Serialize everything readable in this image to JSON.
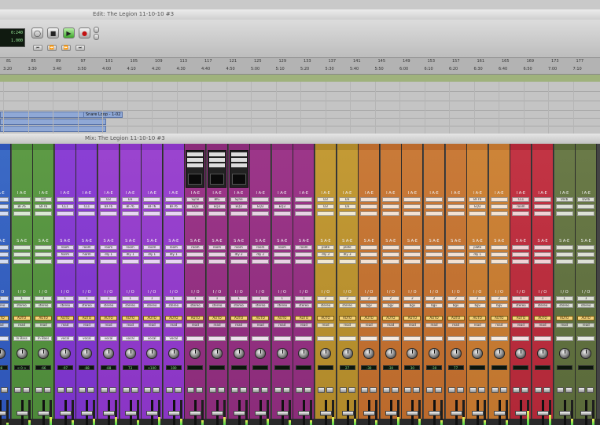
{
  "edit": {
    "title": "Edit: The Legion 11-10-10 #3",
    "counter_main": "0:240",
    "counter_sub": "1.000",
    "bar_numbers": [
      "81",
      "85",
      "89",
      "97",
      "101",
      "105",
      "109",
      "113",
      "117",
      "121",
      "125",
      "129",
      "133",
      "137",
      "141",
      "145",
      "149",
      "153",
      "157",
      "161",
      "165",
      "169",
      "173",
      "177"
    ],
    "time_marks": [
      "3:20",
      "3:30",
      "3:40",
      "3:50",
      "4:00",
      "4:10",
      "4:20",
      "4:30",
      "4:40",
      "4:50",
      "5:00",
      "5:10",
      "5:20",
      "5:30",
      "5:40",
      "5:50",
      "6:00",
      "6:10",
      "6:20",
      "6:30",
      "6:40",
      "6:50",
      "7:00",
      "7:10"
    ],
    "clip_label": "Snare Loop - 1-02"
  },
  "mix": {
    "title": "Mix: The Legion 11-10-10 #3",
    "strips": [
      {
        "color": "#2e55b8",
        "body": "#3b6ac5",
        "insert_a": "",
        "insert_b": "",
        "send_a": "",
        "send_b": "",
        "io": "1",
        "io_b": "stereo",
        "group": "",
        "pan": "-88",
        "meter": 0.1
      },
      {
        "color": "#4d8a3a",
        "body": "#5d9a45",
        "insert_a": "",
        "insert_b": "BF76",
        "send_a": "",
        "send_b": "",
        "io": "1",
        "io_b": "stereo",
        "group": "In Bass",
        "pan": "< 0 >",
        "meter": 0.2
      },
      {
        "color": "#4d8a3a",
        "body": "#5d9a45",
        "insert_a": "Filt",
        "insert_b": "BF76",
        "send_a": "",
        "send_b": "",
        "io": "1",
        "io_b": "stereo",
        "group": "In Bass",
        "pan": "-66",
        "meter": 0.3
      },
      {
        "color": "#7a33c8",
        "body": "#8a3fd4",
        "insert_a": "",
        "insert_b": "CL1",
        "send_a": "room",
        "send_b": "harm",
        "io": "1",
        "io_b": "stereo",
        "group": "vocal",
        "pan": "-97",
        "meter": 0.2
      },
      {
        "color": "#7a33c8",
        "body": "#8a3fd4",
        "insert_a": "",
        "insert_b": "CL1",
        "send_a": "room",
        "send_b": "harm",
        "io": "1",
        "io_b": "stereo",
        "group": "vocal",
        "pan": "-88",
        "meter": 0.25
      },
      {
        "color": "#8a35c5",
        "body": "#9a44cf",
        "insert_a": "D3",
        "insert_b": "BF76",
        "send_a": "room",
        "send_b": "dly 1",
        "io": "1",
        "io_b": "stereo",
        "group": "vocal",
        "pan": "-88",
        "meter": 0.3
      },
      {
        "color": "#8a35c5",
        "body": "#9a44cf",
        "insert_a": "D3",
        "insert_b": "BF76",
        "send_a": "room",
        "send_b": "dly 1",
        "io": "1",
        "io_b": "stereo",
        "group": "vocal",
        "pan": "73",
        "meter": 0.2
      },
      {
        "color": "#8a35c5",
        "body": "#9a44cf",
        "insert_a": "",
        "insert_b": "BF76",
        "send_a": "room",
        "send_b": "dly 1",
        "io": "1",
        "io_b": "stereo",
        "group": "vocal",
        "pan": "+100",
        "meter": 0.3
      },
      {
        "color": "#8a35c5",
        "body": "#9a44cf",
        "insert_a": "",
        "insert_b": "BF76",
        "send_a": "room",
        "send_b": "dly 1",
        "io": "1",
        "io_b": "stereo",
        "group": "vocal",
        "pan": "100",
        "meter": 0.25
      },
      {
        "color": "#8b2c7a",
        "body": "#9c3689",
        "insert_a": "Syne",
        "insert_b": "EQ3",
        "send_a": "room",
        "send_b": "",
        "io": "1",
        "io_b": "stereo",
        "group": "",
        "pan": "",
        "meter": 0.2
      },
      {
        "color": "#8b2c7a",
        "body": "#9c3689",
        "insert_a": "BIG",
        "insert_b": "EQ3",
        "send_a": "room",
        "send_b": "",
        "io": "1",
        "io_b": "stereo",
        "group": "",
        "pan": "",
        "meter": 0.3
      },
      {
        "color": "#8b2c7a",
        "body": "#9c3689",
        "insert_a": "Syne",
        "insert_b": "EQ3",
        "send_a": "room",
        "send_b": "dly 2",
        "io": "1",
        "io_b": "stereo",
        "group": "",
        "pan": "",
        "meter": 0.2
      },
      {
        "color": "#8b2c7a",
        "body": "#9c3689",
        "insert_a": "",
        "insert_b": "EQ3",
        "send_a": "room",
        "send_b": "dly 2",
        "io": "1",
        "io_b": "stereo",
        "group": "",
        "pan": "",
        "meter": 0.25
      },
      {
        "color": "#8b2c7a",
        "body": "#9c3689",
        "insert_a": "",
        "insert_b": "EQ3",
        "send_a": "room",
        "send_b": "",
        "io": "1",
        "io_b": "stereo",
        "group": "",
        "pan": "",
        "meter": 0.2
      },
      {
        "color": "#8b2c7a",
        "body": "#9c3689",
        "insert_a": "",
        "insert_b": "",
        "send_a": "room",
        "send_b": "",
        "io": "1",
        "io_b": "stereo",
        "group": "",
        "pan": "",
        "meter": 0.2
      },
      {
        "color": "#b0892a",
        "body": "#c39a35",
        "insert_a": "D3",
        "insert_b": "D3",
        "send_a": "plate",
        "send_b": "dly 3",
        "io": "2",
        "io_b": "stereo",
        "group": "",
        "pan": "",
        "meter": 0.3
      },
      {
        "color": "#b0892a",
        "body": "#c39a35",
        "insert_a": "D3",
        "insert_b": "D3",
        "send_a": "plate",
        "send_b": "dly 3",
        "io": "2",
        "io_b": "stereo",
        "group": "",
        "pan": "27",
        "meter": 0.25
      },
      {
        "color": "#bb6a2c",
        "body": "#c97a38",
        "insert_a": "",
        "insert_b": "",
        "send_a": "",
        "send_b": "",
        "io": "2",
        "io_b": "bgv",
        "group": "",
        "pan": "-30",
        "meter": 0.2
      },
      {
        "color": "#bb6a2c",
        "body": "#c97a38",
        "insert_a": "",
        "insert_b": "",
        "send_a": "",
        "send_b": "",
        "io": "2",
        "io_b": "bgv",
        "group": "",
        "pan": "-30",
        "meter": 0.3
      },
      {
        "color": "#bb6a2c",
        "body": "#c97a38",
        "insert_a": "",
        "insert_b": "",
        "send_a": "",
        "send_b": "",
        "io": "2",
        "io_b": "bgv",
        "group": "",
        "pan": "30",
        "meter": 0.25
      },
      {
        "color": "#bb6a2c",
        "body": "#c97a38",
        "insert_a": "",
        "insert_b": "",
        "send_a": "",
        "send_b": "",
        "io": "2",
        "io_b": "bgv",
        "group": "",
        "pan": "-30",
        "meter": 0.2
      },
      {
        "color": "#bb6a2c",
        "body": "#c97a38",
        "insert_a": "",
        "insert_b": "",
        "send_a": "",
        "send_b": "",
        "io": "2",
        "io_b": "bgv",
        "group": "",
        "pan": "77",
        "meter": 0.3
      },
      {
        "color": "#c0752e",
        "body": "#cd8438",
        "insert_a": "BF76",
        "insert_b": "EQ3",
        "send_a": "plate",
        "send_b": "dly 1",
        "io": "2",
        "io_b": "bgv",
        "group": "",
        "pan": "",
        "meter": 0.2
      },
      {
        "color": "#c0752e",
        "body": "#cd8438",
        "insert_a": "",
        "insert_b": "",
        "send_a": "",
        "send_b": "",
        "io": "2",
        "io_b": "bgv",
        "group": "",
        "pan": "",
        "meter": 0.2
      },
      {
        "color": "#b12838",
        "body": "#c23444",
        "insert_a": "CL1",
        "insert_b": "room",
        "send_a": "",
        "send_b": "",
        "io": "1",
        "io_b": "stereo",
        "group": "",
        "pan": "",
        "meter": 0.55
      },
      {
        "color": "#b12838",
        "body": "#c23444",
        "insert_a": "",
        "insert_b": "",
        "send_a": "",
        "send_b": "",
        "io": "1",
        "io_b": "stereo",
        "group": "",
        "pan": "",
        "meter": 0.4
      },
      {
        "color": "#5a6a3a",
        "body": "#6a7a48",
        "insert_a": "Verb",
        "insert_b": "",
        "send_a": "",
        "send_b": "",
        "io": "1",
        "io_b": "stereo",
        "group": "",
        "pan": "",
        "meter": 0.25
      },
      {
        "color": "#5a6a3a",
        "body": "#6a7a48",
        "insert_a": "Dvrb",
        "insert_b": "",
        "send_a": "",
        "send_b": "",
        "io": "1",
        "io_b": "stereo",
        "group": "",
        "pan": "",
        "meter": 0.25
      }
    ],
    "section_labels": {
      "inserts": "I A-E",
      "sends": "S A-E",
      "io": "I / O",
      "auto": "AUTO",
      "auto_mode": "read"
    }
  }
}
